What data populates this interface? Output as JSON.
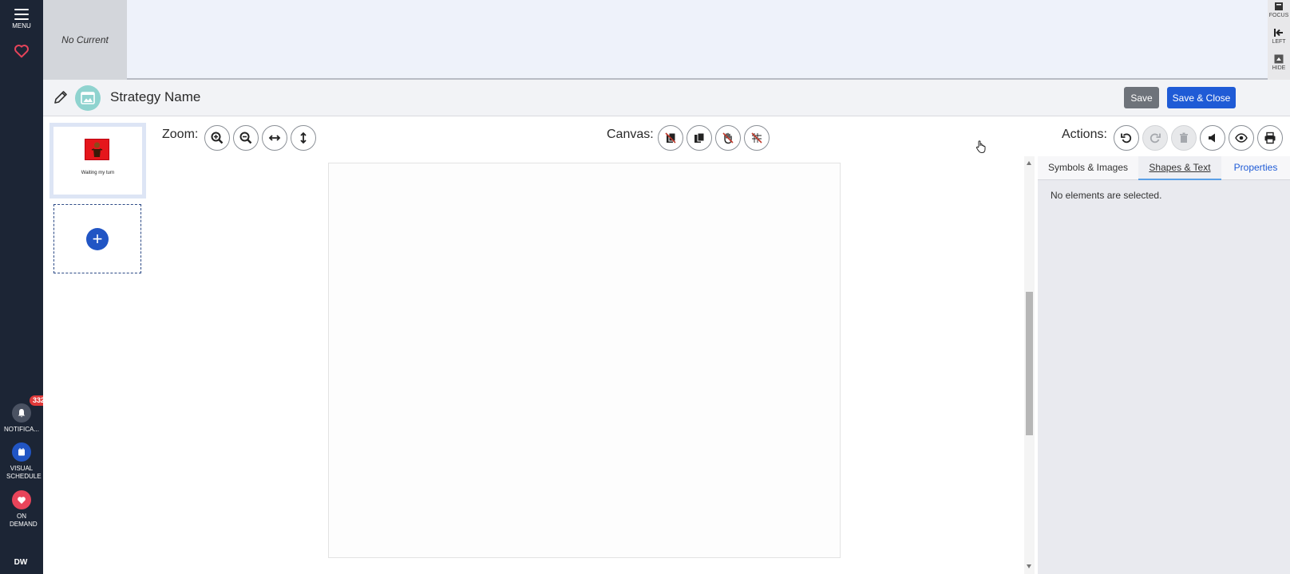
{
  "nav": {
    "menu_label": "MENU",
    "notifications_label": "NOTIFICA...",
    "notifications_count": "332",
    "visual_schedule_label": "VISUAL SCHEDULE",
    "on_demand_label": "ON DEMAND",
    "user_initials": "DW"
  },
  "banner": {
    "current_text": "No Current",
    "tools": {
      "focus": "FOCUS",
      "left": "LEFT",
      "hide": "HIDE"
    }
  },
  "editor": {
    "title": "Strategy Name",
    "save_label": "Save",
    "save_close_label": "Save & Close"
  },
  "pages": [
    {
      "caption": "Waiting my turn"
    }
  ],
  "toolbar": {
    "zoom_label": "Zoom:",
    "canvas_label": "Canvas:",
    "actions_label": "Actions:"
  },
  "panel": {
    "tabs": [
      "Symbols & Images",
      "Shapes & Text",
      "Properties"
    ],
    "active_tab": "Shapes & Text",
    "message": "No elements are selected."
  },
  "colors": {
    "nav_bg": "#1c2535",
    "primary": "#1f5bd6",
    "save_gray": "#6e737a",
    "heart_red": "#e8445a",
    "badge_red": "#e03a3a"
  }
}
